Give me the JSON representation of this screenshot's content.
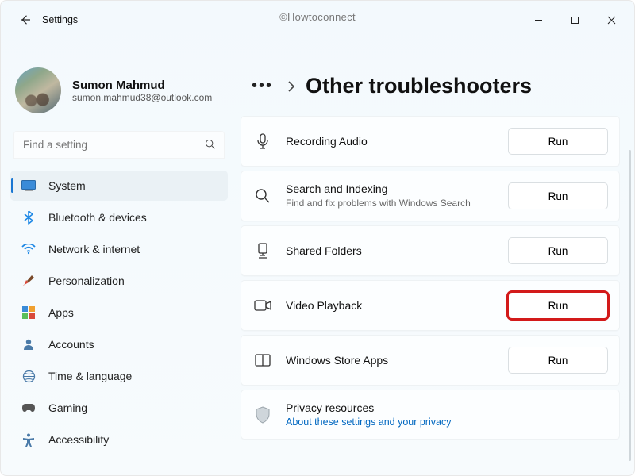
{
  "window": {
    "app_title": "Settings",
    "watermark": "©Howtoconnect"
  },
  "profile": {
    "name": "Sumon Mahmud",
    "email": "sumon.mahmud38@outlook.com"
  },
  "search": {
    "placeholder": "Find a setting"
  },
  "sidebar": {
    "items": [
      {
        "icon": "system",
        "label": "System",
        "active": true
      },
      {
        "icon": "bluetooth",
        "label": "Bluetooth & devices"
      },
      {
        "icon": "wifi",
        "label": "Network & internet"
      },
      {
        "icon": "brush",
        "label": "Personalization"
      },
      {
        "icon": "apps",
        "label": "Apps"
      },
      {
        "icon": "person",
        "label": "Accounts"
      },
      {
        "icon": "globe-clock",
        "label": "Time & language"
      },
      {
        "icon": "gaming",
        "label": "Gaming"
      },
      {
        "icon": "accessibility",
        "label": "Accessibility"
      }
    ]
  },
  "breadcrumb": {
    "ellipsis": "…",
    "current": "Other troubleshooters"
  },
  "buttons": {
    "run": "Run"
  },
  "troubleshooters": [
    {
      "icon": "mic",
      "title": "Recording Audio"
    },
    {
      "icon": "search",
      "title": "Search and Indexing",
      "desc": "Find and fix problems with Windows Search"
    },
    {
      "icon": "shared-folder",
      "title": "Shared Folders"
    },
    {
      "icon": "video",
      "title": "Video Playback",
      "highlight": true
    },
    {
      "icon": "store",
      "title": "Windows Store Apps"
    }
  ],
  "privacy": {
    "title": "Privacy resources",
    "link": "About these settings and your privacy"
  }
}
